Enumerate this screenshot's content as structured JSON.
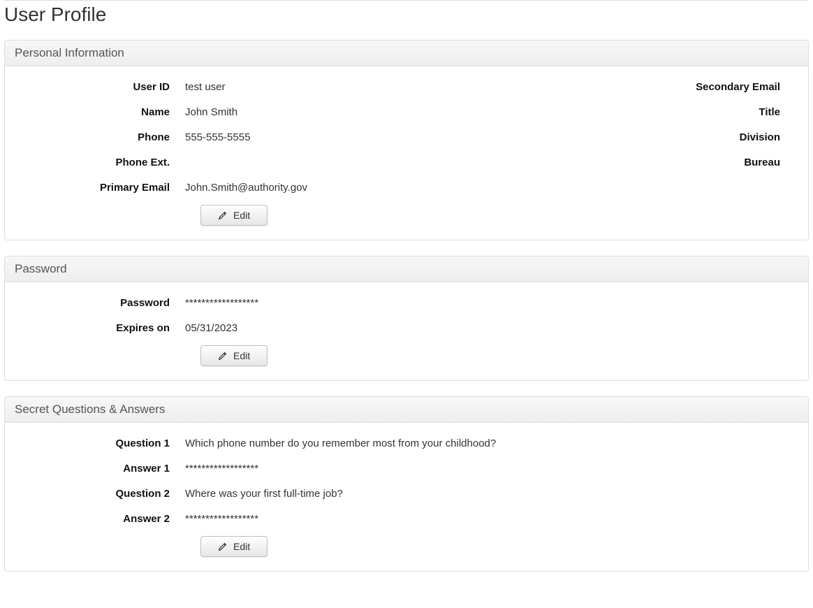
{
  "page_title": "User Profile",
  "buttons": {
    "edit": "Edit"
  },
  "sections": {
    "personal": {
      "title": "Personal Information",
      "left": {
        "user_id": {
          "label": "User ID",
          "value": "test user"
        },
        "name": {
          "label": "Name",
          "value": "John Smith"
        },
        "phone": {
          "label": "Phone",
          "value": "555-555-5555"
        },
        "phone_ext": {
          "label": "Phone Ext.",
          "value": ""
        },
        "primary_email": {
          "label": "Primary Email",
          "value": "John.Smith@authority.gov"
        }
      },
      "right": {
        "secondary_email": {
          "label": "Secondary Email",
          "value": ""
        },
        "title": {
          "label": "Title",
          "value": ""
        },
        "division": {
          "label": "Division",
          "value": ""
        },
        "bureau": {
          "label": "Bureau",
          "value": ""
        }
      }
    },
    "password": {
      "title": "Password",
      "password": {
        "label": "Password",
        "value": "******************"
      },
      "expires_on": {
        "label": "Expires on",
        "value": "05/31/2023"
      }
    },
    "secret": {
      "title": "Secret Questions & Answers",
      "q1": {
        "label": "Question 1",
        "value": "Which phone number do you remember most from your childhood?"
      },
      "a1": {
        "label": "Answer 1",
        "value": "******************"
      },
      "q2": {
        "label": "Question 2",
        "value": "Where was your first full-time job?"
      },
      "a2": {
        "label": "Answer 2",
        "value": "******************"
      }
    }
  }
}
